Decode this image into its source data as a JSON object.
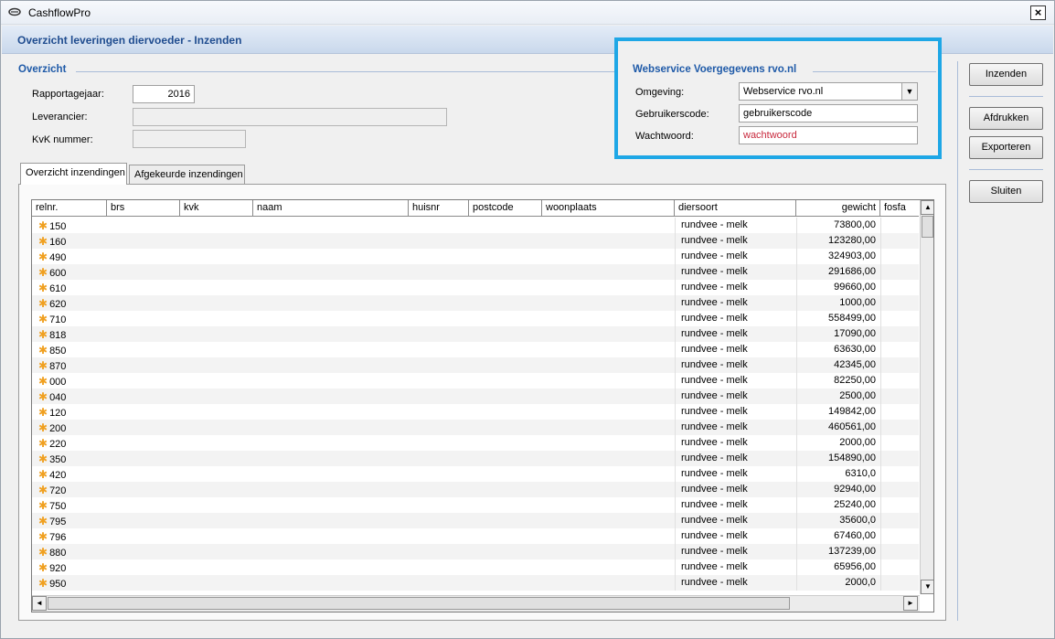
{
  "window": {
    "title": "CashflowPro",
    "close_label": "×"
  },
  "subtitle": "Overzicht leveringen diervoeder - Inzenden",
  "overview": {
    "heading": "Overzicht",
    "rapportagejaar_label": "Rapportagejaar:",
    "rapportagejaar_value": "2016",
    "leverancier_label": "Leverancier:",
    "leverancier_value": "",
    "kvk_label": "KvK nummer:",
    "kvk_value": ""
  },
  "webservice": {
    "heading": "Webservice Voergegevens rvo.nl",
    "omgeving_label": "Omgeving:",
    "omgeving_value": "Webservice rvo.nl",
    "gebruikerscode_label": "Gebruikerscode:",
    "gebruikerscode_value": "gebruikerscode",
    "wachtwoord_label": "Wachtwoord:",
    "wachtwoord_value": "wachtwoord",
    "highlight_color": "#1ea7e6"
  },
  "tabs": [
    {
      "label": "Overzicht inzendingen",
      "active": true
    },
    {
      "label": "Afgekeurde inzendingen",
      "active": false
    }
  ],
  "grid": {
    "columns": [
      "relnr.",
      "brs",
      "kvk",
      "naam",
      "huisnr",
      "postcode",
      "woonplaats",
      "diersoort",
      "gewicht",
      "fosfa"
    ],
    "rows": [
      {
        "relnr": "150",
        "diersoort": "rundvee - melk",
        "gewicht": "73800,00"
      },
      {
        "relnr": "160",
        "diersoort": "rundvee - melk",
        "gewicht": "123280,00"
      },
      {
        "relnr": "490",
        "diersoort": "rundvee - melk",
        "gewicht": "324903,00"
      },
      {
        "relnr": "600",
        "diersoort": "rundvee - melk",
        "gewicht": "291686,00"
      },
      {
        "relnr": "610",
        "diersoort": "rundvee - melk",
        "gewicht": "99660,00"
      },
      {
        "relnr": "620",
        "diersoort": "rundvee - melk",
        "gewicht": "1000,00"
      },
      {
        "relnr": "710",
        "diersoort": "rundvee - melk",
        "gewicht": "558499,00"
      },
      {
        "relnr": "818",
        "diersoort": "rundvee - melk",
        "gewicht": "17090,00"
      },
      {
        "relnr": "850",
        "diersoort": "rundvee - melk",
        "gewicht": "63630,00"
      },
      {
        "relnr": "870",
        "diersoort": "rundvee - melk",
        "gewicht": "42345,00"
      },
      {
        "relnr": "000",
        "diersoort": "rundvee - melk",
        "gewicht": "82250,00"
      },
      {
        "relnr": "040",
        "diersoort": "rundvee - melk",
        "gewicht": "2500,00"
      },
      {
        "relnr": "120",
        "diersoort": "rundvee - melk",
        "gewicht": "149842,00"
      },
      {
        "relnr": "200",
        "diersoort": "rundvee - melk",
        "gewicht": "460561,00"
      },
      {
        "relnr": "220",
        "diersoort": "rundvee - melk",
        "gewicht": "2000,00"
      },
      {
        "relnr": "350",
        "diersoort": "rundvee - melk",
        "gewicht": "154890,00"
      },
      {
        "relnr": "420",
        "diersoort": "rundvee - melk",
        "gewicht": "6310,0"
      },
      {
        "relnr": "720",
        "diersoort": "rundvee - melk",
        "gewicht": "92940,00"
      },
      {
        "relnr": "750",
        "diersoort": "rundvee - melk",
        "gewicht": "25240,00"
      },
      {
        "relnr": "795",
        "diersoort": "rundvee - melk",
        "gewicht": "35600,0"
      },
      {
        "relnr": "796",
        "diersoort": "rundvee - melk",
        "gewicht": "67460,00"
      },
      {
        "relnr": "880",
        "diersoort": "rundvee - melk",
        "gewicht": "137239,00"
      },
      {
        "relnr": "920",
        "diersoort": "rundvee - melk",
        "gewicht": "65956,00"
      },
      {
        "relnr": "950",
        "diersoort": "rundvee - melk",
        "gewicht": "2000,0"
      }
    ]
  },
  "buttons": {
    "inzenden": "Inzenden",
    "afdrukken": "Afdrukken",
    "exporteren": "Exporteren",
    "sluiten": "Sluiten"
  }
}
